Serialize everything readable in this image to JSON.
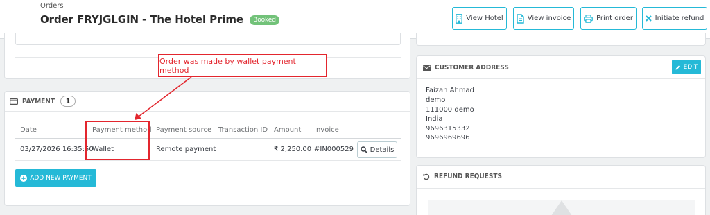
{
  "header": {
    "breadcrumb": "Orders",
    "title": "Order FRYJGLGIN - The Hotel Prime",
    "status": "Booked",
    "buttons": {
      "view_hotel": "View Hotel",
      "view_invoice": "View invoice",
      "print_order": "Print order",
      "initiate_refund": "Initiate refund"
    }
  },
  "payment": {
    "heading": "PAYMENT",
    "count": "1",
    "columns": [
      "Date",
      "Payment method",
      "Payment source",
      "Transaction ID",
      "Amount",
      "Invoice"
    ],
    "rows": [
      {
        "date": "03/27/2026 16:35:50",
        "method": "Wallet",
        "source": "Remote payment",
        "transaction_id": "",
        "amount": "₹ 2,250.00",
        "invoice": "#IN000529",
        "details_label": "Details"
      }
    ],
    "add_button": "ADD NEW PAYMENT"
  },
  "customer_address": {
    "heading": "CUSTOMER ADDRESS",
    "edit_label": "EDIT",
    "lines": [
      "Faizan Ahmad",
      "demo",
      "111000 demo",
      "India",
      "9696315332",
      "9696969696"
    ]
  },
  "refund": {
    "heading": "REFUND REQUESTS"
  },
  "annotation": {
    "text": "Order was made by wallet payment method"
  },
  "colors": {
    "accent": "#25b9d7",
    "booked": "#72c279",
    "annotation": "#e3262e"
  }
}
